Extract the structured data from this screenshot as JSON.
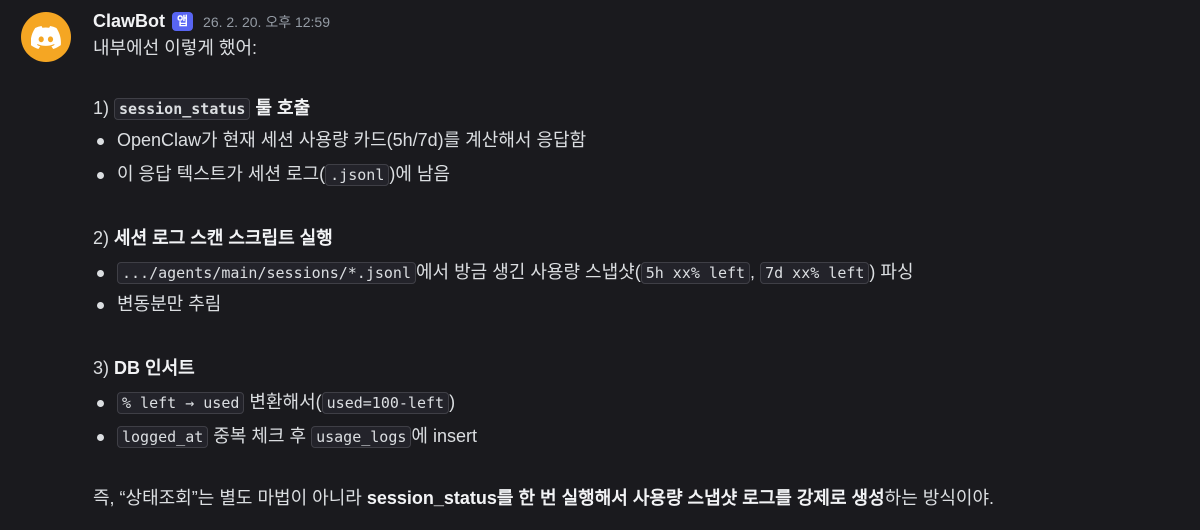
{
  "message": {
    "author": "ClawBot",
    "badge": "앱",
    "timestamp": "26. 2. 20. 오후 12:59",
    "intro": "내부에선 이렇게 했어:",
    "step1": {
      "num": "1)",
      "code": "session_status",
      "title": "툴 호출",
      "b1": "OpenClaw가 현재 세션 사용량 카드(5h/7d)를 계산해서 응답함",
      "b2_pre": "이 응답 텍스트가 세션 로그(",
      "b2_code": ".jsonl",
      "b2_post": ")에 남음"
    },
    "step2": {
      "num": "2)",
      "title": "세션 로그 스캔 스크립트 실행",
      "b1_code1": ".../agents/main/sessions/*.jsonl",
      "b1_text1": "에서 방금 생긴 사용량 스냅샷(",
      "b1_code2": "5h xx% left",
      "b1_comma": ",",
      "b1_code3": "7d xx% left",
      "b1_text2": ") 파싱",
      "b2": "변동분만 추림"
    },
    "step3": {
      "num": "3)",
      "title": "DB 인서트",
      "b1_code1": "% left → used",
      "b1_text1": " 변환해서(",
      "b1_code2": "used=100-left",
      "b1_text2": ")",
      "b2_code1": "logged_at",
      "b2_text1": " 중복 체크 후 ",
      "b2_code2": "usage_logs",
      "b2_text2": "에 insert"
    },
    "summary": {
      "pre": "즉, “상태조회”는 별도 마법이 아니라 ",
      "bold": "session_status를 한 번 실행해서 사용량 스냅샷 로그를 강제로 생성",
      "post": "하는 방식이야."
    }
  }
}
